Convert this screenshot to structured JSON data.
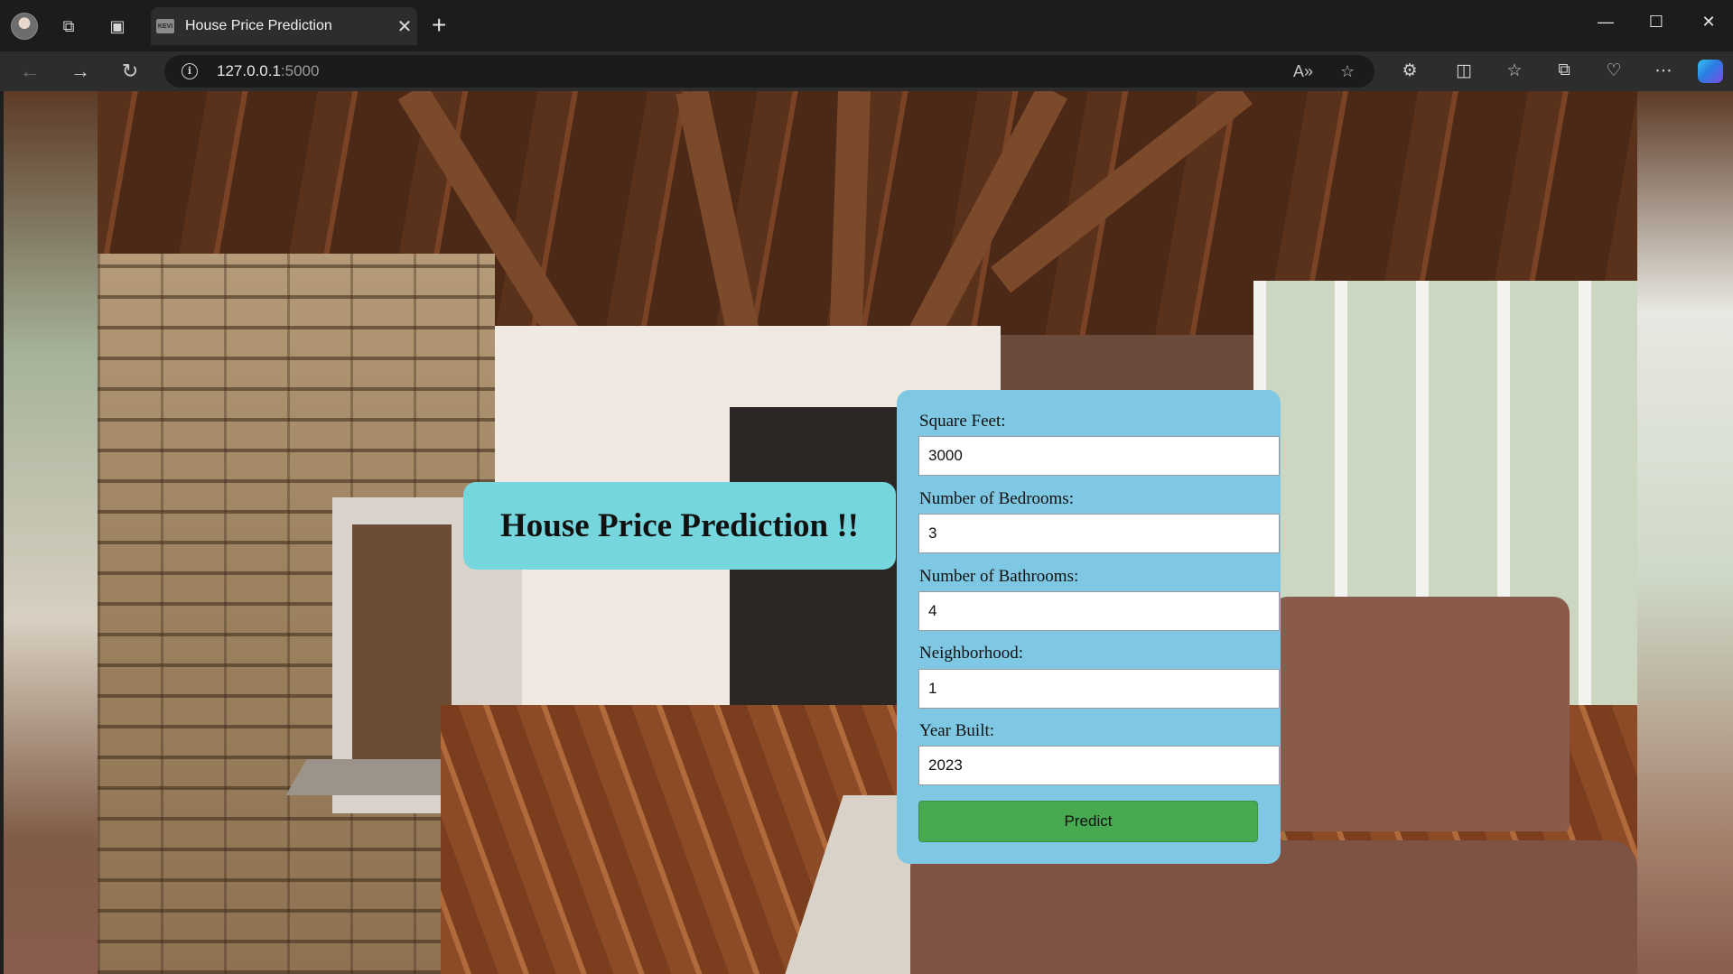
{
  "browser": {
    "tab": {
      "title": "House Price Prediction",
      "favicon_text": "KEVI"
    },
    "url": {
      "host": "127.0.0.1",
      "port": ":5000"
    },
    "icons": {
      "workspaces": "workspaces-icon",
      "tab_actions": "vertical-tabs-icon",
      "back": "back-arrow-icon",
      "forward": "forward-arrow-icon",
      "refresh": "refresh-icon",
      "read_aloud": "read-aloud-icon",
      "favorite": "star-icon",
      "extensions": "extensions-icon",
      "split_screen": "split-screen-icon",
      "favorites": "favorites-icon",
      "collections": "collections-icon",
      "performance": "heart-icon",
      "more": "more-icon",
      "copilot": "copilot-icon"
    }
  },
  "page": {
    "heading": "House Price Prediction !!",
    "form": {
      "fields": [
        {
          "label": "Square Feet:",
          "value": "3000"
        },
        {
          "label": "Number of Bedrooms:",
          "value": "3"
        },
        {
          "label": "Number of Bathrooms:",
          "value": "4"
        },
        {
          "label": "Neighborhood:",
          "value": "1"
        },
        {
          "label": "Year Built:",
          "value": "2023"
        }
      ],
      "submit_label": "Predict"
    }
  },
  "colors": {
    "title_card": "#75d6de",
    "form_card": "#7ec8e3",
    "predict_button": "#47aa50"
  }
}
